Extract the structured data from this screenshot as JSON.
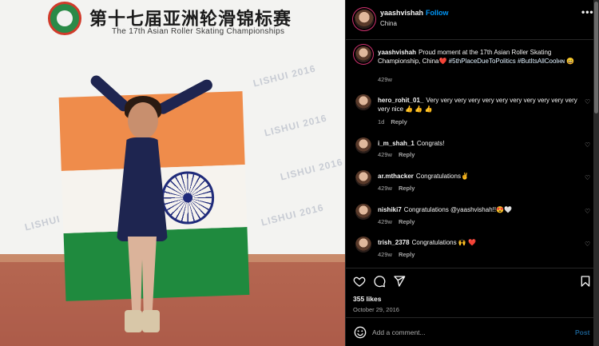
{
  "photo": {
    "banner_chinese": "第十七届亚洲轮滑锦标赛",
    "banner_english": "The 17th Asian Roller Skating Championships",
    "watermark": "LISHUI 2016"
  },
  "header": {
    "username": "yaashvishah",
    "separator": "•",
    "follow_label": "Follow",
    "location": "China",
    "more_label": "•••"
  },
  "caption": {
    "username": "yaashvishah",
    "text": "Proud moment at the 17th Asian Roller Skating Championship, China❤️",
    "hashtags": "#5thPlaceDueToPolitics #ButItsAllCoolʜɴ 😄",
    "age": "429w"
  },
  "comments": [
    {
      "username": "hero_rohit_01_",
      "text": "Very very very very very very very very very very very very nice 👍 👍 👍",
      "age": "1d",
      "reply_label": "Reply"
    },
    {
      "username": "i_m_shah_1",
      "text": "Congrats!",
      "age": "429w",
      "reply_label": "Reply"
    },
    {
      "username": "ar.mthacker",
      "text": "Congratulations✌️",
      "age": "429w",
      "reply_label": "Reply"
    },
    {
      "username": "nishiki7",
      "text": "Congratulations @yaashvishah!!😍🤍",
      "age": "429w",
      "reply_label": "Reply"
    },
    {
      "username": "trish_2378",
      "text": "Congratulations 🙌 ❤️",
      "age": "429w",
      "reply_label": "Reply"
    }
  ],
  "actions": {
    "likes": "355 likes",
    "date": "October 29, 2016"
  },
  "composer": {
    "placeholder": "Add a comment...",
    "post_label": "Post"
  },
  "icons": {
    "like": "heart-icon",
    "comment": "comment-icon",
    "share": "share-icon",
    "save": "bookmark-icon",
    "emoji": "emoji-icon",
    "comment_like": "small-heart-icon"
  },
  "colors": {
    "background": "#000000",
    "link_blue": "#0095f6",
    "muted": "#a8a8a8",
    "story_ring": "#d0326f"
  }
}
